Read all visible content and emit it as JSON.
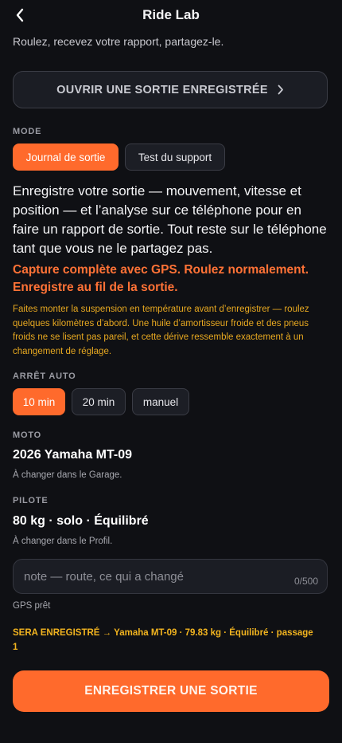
{
  "header": {
    "title": "Ride Lab",
    "subtitle": "Roulez, recevez votre rapport, partagez-le.",
    "back_icon": "chevron-left-icon"
  },
  "open_recorded": {
    "label": "OUVRIR UNE SORTIE ENREGISTRÉE",
    "icon": "chevron-right-icon"
  },
  "mode": {
    "label": "MODE",
    "options": [
      "Journal de sortie",
      "Test du support"
    ],
    "selected": "Journal de sortie",
    "description": "Enregistre votre sortie — mouvement, vitesse et position — et l’analyse sur ce téléphone pour en faire un rapport de sortie. Tout reste sur le téléphone tant que vous ne le partagez pas.",
    "capture_note": "Capture complète avec GPS. Roulez normalement. Enregistre au fil de la sortie.",
    "warmup_note": "Faites monter la suspension en température avant d’enregistrer — roulez quelques kilomètres d’abord. Une huile d’amortisseur froide et des pneus froids ne se lisent pas pareil, et cette dérive ressemble exactement à un changement de réglage."
  },
  "auto_stop": {
    "label": "ARRÊT AUTO",
    "options": [
      "10 min",
      "20 min",
      "manuel"
    ],
    "selected": "10 min"
  },
  "bike": {
    "label": "MOTO",
    "value": "2026 Yamaha MT-09",
    "hint": "À changer dans le Garage."
  },
  "rider": {
    "label": "PILOTE",
    "value": "80 kg · solo · Équilibré",
    "hint": "À changer dans le Profil."
  },
  "note": {
    "placeholder": "note — route, ce qui a changé",
    "value": "",
    "counter": "0/500"
  },
  "gps_status": "GPS prêt",
  "summary": "SERA ENREGISTRÉ → Yamaha MT-09 · 79.83 kg · Équilibré · passage 1",
  "record_button": "ENREGISTRER UNE SORTIE",
  "colors": {
    "background": "#0f1014",
    "accent": "#ff6a2c",
    "warning": "#e7a820"
  }
}
